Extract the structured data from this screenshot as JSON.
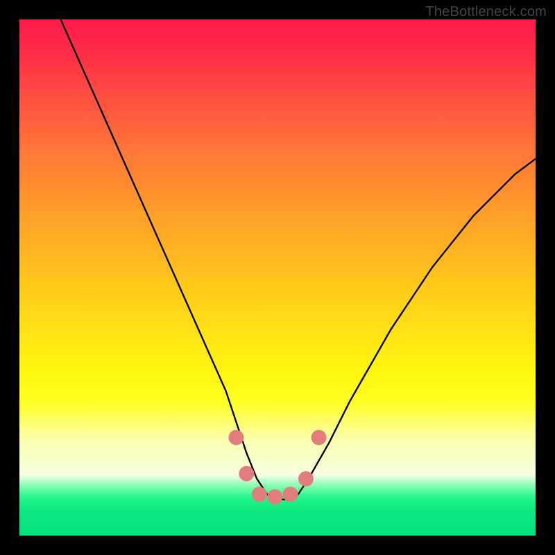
{
  "watermark": "TheBottleneck.com",
  "colors": {
    "frame": "#000000",
    "curve": "#000000",
    "marker_fill": "#e27d7d",
    "marker_stroke": "#d96c6c",
    "gradient_top": "#ff1a4a",
    "gradient_mid": "#ffe614",
    "gradient_bottom": "#08df7e"
  },
  "chart_data": {
    "type": "line",
    "title": "",
    "xlabel": "",
    "ylabel": "",
    "xlim": [
      0,
      100
    ],
    "ylim": [
      0,
      100
    ],
    "grid": false,
    "legend": false,
    "series": [
      {
        "name": "bottleneck-curve",
        "x": [
          8,
          12,
          16,
          20,
          24,
          28,
          32,
          36,
          40,
          42,
          44,
          46,
          48,
          50,
          52,
          54,
          56,
          60,
          64,
          68,
          72,
          76,
          80,
          84,
          88,
          92,
          96,
          100
        ],
        "y": [
          100,
          91,
          82,
          73,
          64,
          55,
          46,
          37,
          28,
          22,
          16,
          11,
          8,
          7,
          7,
          8,
          11,
          18,
          26,
          33,
          40,
          46,
          52,
          57,
          62,
          66,
          70,
          73
        ]
      }
    ],
    "markers": [
      {
        "name": "left-cap-top",
        "x": 42.0,
        "y": 19.0,
        "r": 11
      },
      {
        "name": "left-cap-bottom",
        "x": 44.0,
        "y": 12.0,
        "r": 11
      },
      {
        "name": "flat-1",
        "x": 46.5,
        "y": 8.0,
        "r": 11
      },
      {
        "name": "flat-2",
        "x": 49.5,
        "y": 7.5,
        "r": 11
      },
      {
        "name": "flat-3",
        "x": 52.5,
        "y": 8.0,
        "r": 11
      },
      {
        "name": "right-cap-bottom",
        "x": 55.5,
        "y": 11.0,
        "r": 11
      },
      {
        "name": "right-cap-top",
        "x": 58.0,
        "y": 19.0,
        "r": 11
      }
    ],
    "heat_background": {
      "type": "vertical-gradient",
      "stops": [
        {
          "y": 100,
          "color": "#ff1a4a"
        },
        {
          "y": 50,
          "color": "#ffe614"
        },
        {
          "y": 12,
          "color": "#f7ffe0"
        },
        {
          "y": 0,
          "color": "#08df7e"
        }
      ]
    }
  }
}
